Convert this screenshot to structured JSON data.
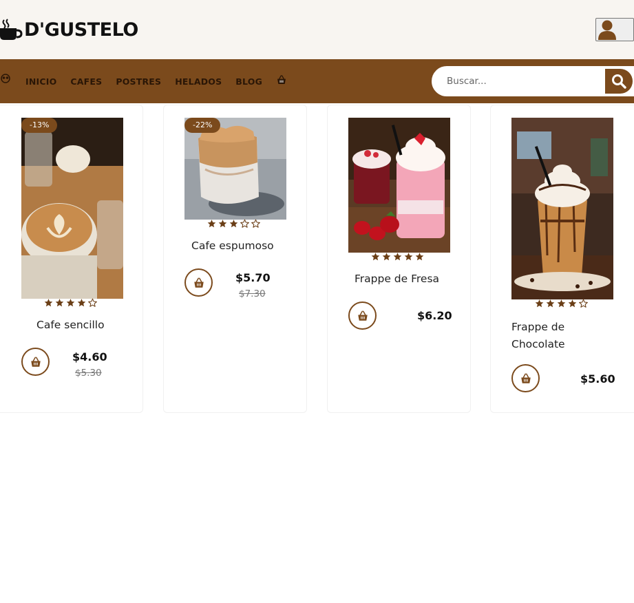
{
  "brand": {
    "name": "D'GUSTELO",
    "icon": "coffee-cup-icon"
  },
  "user": {
    "icon": "user-icon"
  },
  "nav": {
    "items": [
      "INICIO",
      "CAFES",
      "POSTRES",
      "HELADOS",
      "BLOG"
    ],
    "left_icon": "face-icon",
    "cart_icon": "basket-icon"
  },
  "search": {
    "placeholder": "Buscar...",
    "value": "",
    "icon": "search-icon"
  },
  "colors": {
    "accent": "#7b4a1c",
    "topbar": "#f8f5f1",
    "star": "#6b3f17"
  },
  "products": [
    {
      "name": "Cafe sencillo",
      "badge": "-13%",
      "rating": 4,
      "price": "$4.60",
      "old_price": "$5.30",
      "image": "latte-art-photo"
    },
    {
      "name": "Cafe espumoso",
      "badge": "-22%",
      "rating": 3,
      "price": "$5.70",
      "old_price": "$7.30",
      "image": "dalgona-coffee-photo"
    },
    {
      "name": "Frappe de Fresa",
      "badge": "",
      "rating": 5,
      "price": "$6.20",
      "old_price": "",
      "image": "strawberry-frappe-photo"
    },
    {
      "name": "Frappe de\nChocolate",
      "badge": "",
      "rating": 4,
      "price": "$5.60",
      "old_price": "",
      "image": "chocolate-frappe-photo"
    }
  ]
}
